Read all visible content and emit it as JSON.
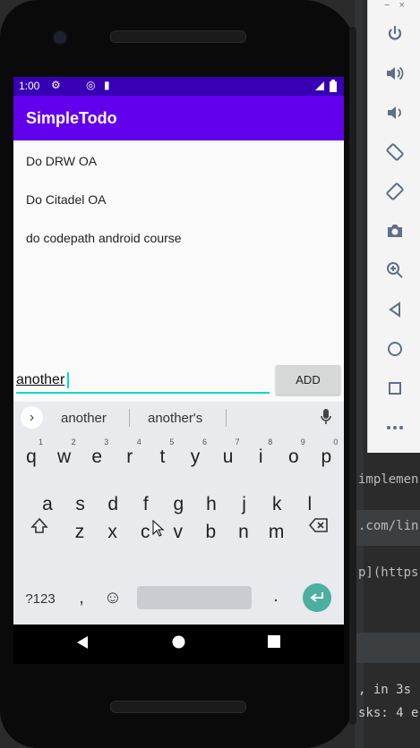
{
  "ide": {
    "lines": [
      "s",
      "*",
      "l",
      "f",
      "t",
      "*",
      "c",
      "a"
    ],
    "code_line_1": "implemen",
    "code_line_2": ".com/lin",
    "code_line_3": "p](https",
    "status_line_1": ", in 3s",
    "status_line_2": "sks: 4 e"
  },
  "emulator_panel": {
    "top_icons": [
      "−",
      "×"
    ],
    "buttons": [
      "power-icon",
      "volume-up-icon",
      "volume-down-icon",
      "rotate-left-icon",
      "rotate-right-icon",
      "camera-icon",
      "zoom-icon",
      "back-icon",
      "home-icon",
      "overview-icon",
      "more-icon"
    ]
  },
  "status_bar": {
    "time": "1:00"
  },
  "app": {
    "title": "SimpleTodo",
    "items": [
      "Do DRW OA",
      "Do Citadel OA",
      "do codepath android course"
    ],
    "input_value": "another",
    "add_label": "ADD"
  },
  "keyboard": {
    "suggestions": [
      "another",
      "another's"
    ],
    "row1": [
      "q",
      "w",
      "e",
      "r",
      "t",
      "y",
      "u",
      "i",
      "o",
      "p"
    ],
    "row1_hints": [
      "1",
      "2",
      "3",
      "4",
      "5",
      "6",
      "7",
      "8",
      "9",
      "0"
    ],
    "row2": [
      "a",
      "s",
      "d",
      "f",
      "g",
      "h",
      "j",
      "k",
      "l"
    ],
    "row3": [
      "z",
      "x",
      "c",
      "v",
      "b",
      "n",
      "m"
    ],
    "symbols_label": "?123",
    "comma": ",",
    "period": "."
  },
  "colors": {
    "status_bar": "#3700b3",
    "app_bar": "#6200ee",
    "accent": "#03dac5",
    "enter_key": "#4caf9f"
  }
}
